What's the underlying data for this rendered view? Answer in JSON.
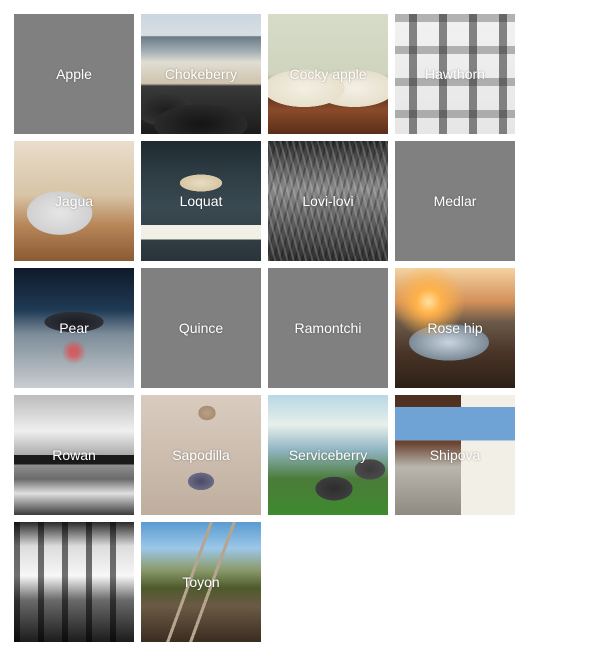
{
  "gallery": {
    "tiles": [
      {
        "label": "Apple",
        "image": "none"
      },
      {
        "label": "Chokeberry",
        "image": "beach-rocks"
      },
      {
        "label": "Cocky apple",
        "image": "open-book"
      },
      {
        "label": "Hawthorn",
        "image": "flatlay-gadgets"
      },
      {
        "label": "Jagua",
        "image": "laptop-desk"
      },
      {
        "label": "Loquat",
        "image": "workspace-keyboard"
      },
      {
        "label": "Lovi-lovi",
        "image": "grass-bw"
      },
      {
        "label": "Medlar",
        "image": "none"
      },
      {
        "label": "Pear",
        "image": "gamepad"
      },
      {
        "label": "Quince",
        "image": "none"
      },
      {
        "label": "Ramontchi",
        "image": "none"
      },
      {
        "label": "Rose hip",
        "image": "sunset-road-puddle"
      },
      {
        "label": "Rowan",
        "image": "pier-bw"
      },
      {
        "label": "Sapodilla",
        "image": "footprints-sand"
      },
      {
        "label": "Serviceberry",
        "image": "rocks-grass"
      },
      {
        "label": "Shipova",
        "image": "laptop-notebook"
      },
      {
        "label": "",
        "image": "cafe-interior-bw"
      },
      {
        "label": "Toyon",
        "image": "railway-tracks"
      }
    ]
  },
  "colors": {
    "placeholder_tile": "#808080",
    "caption_text": "#ffffff",
    "background": "#ffffff"
  }
}
